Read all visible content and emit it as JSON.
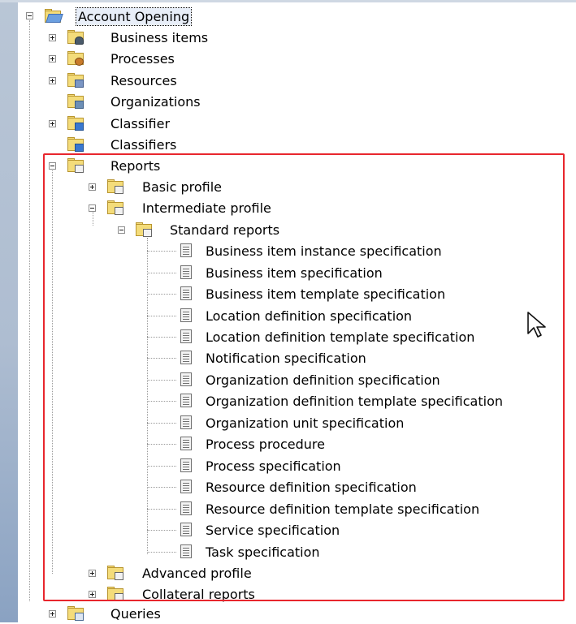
{
  "tree": {
    "root": {
      "label": "Account Opening",
      "expanded": true,
      "icon": "open-folder-icon"
    },
    "items": [
      {
        "label": "Business items",
        "icon": "business-items-folder-icon",
        "expander": "plus"
      },
      {
        "label": "Processes",
        "icon": "processes-folder-icon",
        "expander": "plus"
      },
      {
        "label": "Resources",
        "icon": "resources-folder-icon",
        "expander": "plus"
      },
      {
        "label": "Organizations",
        "icon": "organizations-folder-icon",
        "expander": "none"
      },
      {
        "label": "Classifier",
        "icon": "classifier-folder-icon",
        "expander": "plus"
      },
      {
        "label": "Classifiers",
        "icon": "classifiers-folder-icon",
        "expander": "none"
      },
      {
        "label": "Reports",
        "icon": "reports-folder-icon",
        "expander": "minus"
      },
      {
        "label": "Queries",
        "icon": "queries-folder-icon",
        "expander": "plus"
      }
    ],
    "reports": {
      "basic_profile": "Basic profile",
      "intermediate_profile": "Intermediate profile",
      "standard_reports": "Standard reports",
      "advanced_profile": "Advanced profile",
      "collateral_reports": "Collateral reports"
    },
    "standard_report_items": [
      "Business item instance specification",
      "Business item specification",
      "Business item template specification",
      "Location definition specification",
      "Location definition template specification",
      "Notification specification",
      "Organization definition specification",
      "Organization definition template specification",
      "Organization unit specification",
      "Process procedure",
      "Process specification",
      "Resource definition specification",
      "Resource definition template specification",
      "Service specification",
      "Task specification"
    ]
  },
  "highlight": {
    "color": "#e8262d"
  },
  "colors": {
    "folder": "#f4dc7a",
    "open_folder": "#6b9fe0",
    "background_strip": "#aebdd1"
  }
}
